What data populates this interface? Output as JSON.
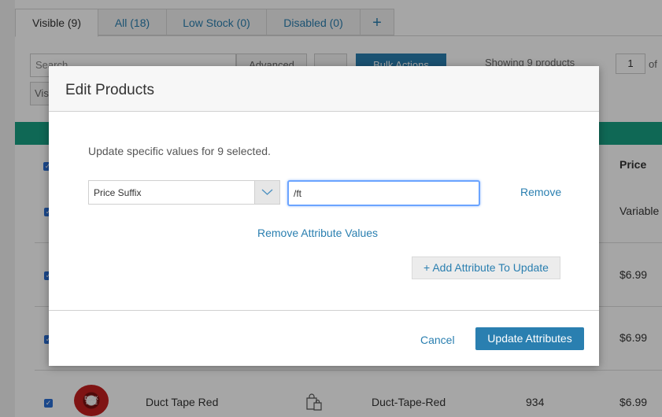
{
  "tabs": [
    {
      "label": "Visible (9)"
    },
    {
      "label": "All (18)"
    },
    {
      "label": "Low Stock (0)"
    },
    {
      "label": "Disabled (0)"
    },
    {
      "label": "+"
    }
  ],
  "toolbar": {
    "search_placeholder": "Search",
    "advanced_label": "Advanced",
    "bulk_actions_label": "Bulk Actions",
    "showing_text": "Showing 9 products",
    "page_value": "1",
    "page_of": "of",
    "visibility_label": "Vis"
  },
  "table": {
    "price_header": "Price",
    "rows": [
      {
        "price": "Variable"
      },
      {
        "price": "$6.99"
      },
      {
        "price": "$6.99"
      },
      {
        "name": "Duct Tape Red",
        "sku": "Duct-Tape-Red",
        "stock": "934",
        "price": "$6.99",
        "thumb_text": "DUCK TAPE"
      }
    ]
  },
  "modal": {
    "title": "Edit Products",
    "help_text": "Update specific values for 9 selected.",
    "attribute_select": "Price Suffix",
    "attribute_value": "/ft",
    "remove_label": "Remove",
    "remove_attr_values_label": "Remove Attribute Values",
    "add_attr_label": "+ Add Attribute To Update",
    "cancel_label": "Cancel",
    "update_label": "Update Attributes"
  }
}
